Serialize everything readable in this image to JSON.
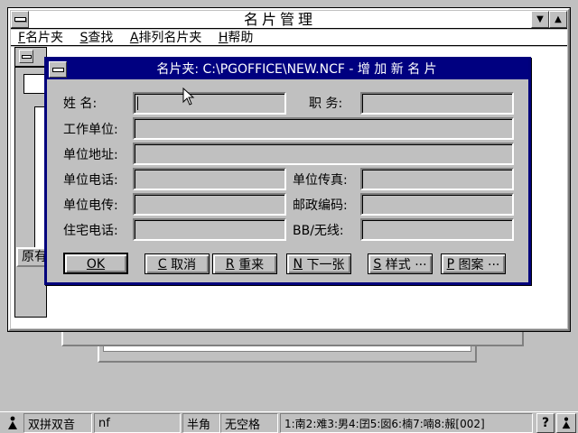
{
  "main_window": {
    "title": "名片管理",
    "menu": [
      {
        "key": "F",
        "label": "名片夹"
      },
      {
        "key": "S",
        "label": "查找"
      },
      {
        "key": "A",
        "label": "排列名片夹"
      },
      {
        "key": "H",
        "label": "帮助"
      }
    ],
    "background_text": "原有"
  },
  "dialog": {
    "title": "名片夹: C:\\PGOFFICE\\NEW.NCF - 增 加 新 名 片",
    "fields": {
      "name": {
        "label": "姓 名:",
        "value": ""
      },
      "position": {
        "label": "职 务:",
        "value": ""
      },
      "company": {
        "label": "工作单位:",
        "value": ""
      },
      "address": {
        "label": "单位地址:",
        "value": ""
      },
      "office_phone": {
        "label": "单位电话:",
        "value": ""
      },
      "office_fax": {
        "label": "单位传真:",
        "value": ""
      },
      "office_telex": {
        "label": "单位电传:",
        "value": ""
      },
      "postcode": {
        "label": "邮政编码:",
        "value": ""
      },
      "home_phone": {
        "label": "住宅电话:",
        "value": ""
      },
      "pager": {
        "label": "BB/无线:",
        "value": ""
      }
    },
    "buttons": {
      "ok": {
        "key": "OK",
        "label": ""
      },
      "cancel": {
        "key": "C",
        "label": "取消"
      },
      "reset": {
        "key": "R",
        "label": "重来"
      },
      "next": {
        "key": "N",
        "label": "下一张"
      },
      "style": {
        "key": "S",
        "label": "样式 ···"
      },
      "pattern": {
        "key": "P",
        "label": "图案 ···"
      }
    }
  },
  "statusbar": {
    "ime_name": "双拼双音",
    "input": "nf",
    "width_mode": "半角",
    "space_mode": "无空格",
    "candidates": "1:南2:难3:男4:囝5:囡6:楠7:喃8:赧[002]",
    "help": "?"
  }
}
